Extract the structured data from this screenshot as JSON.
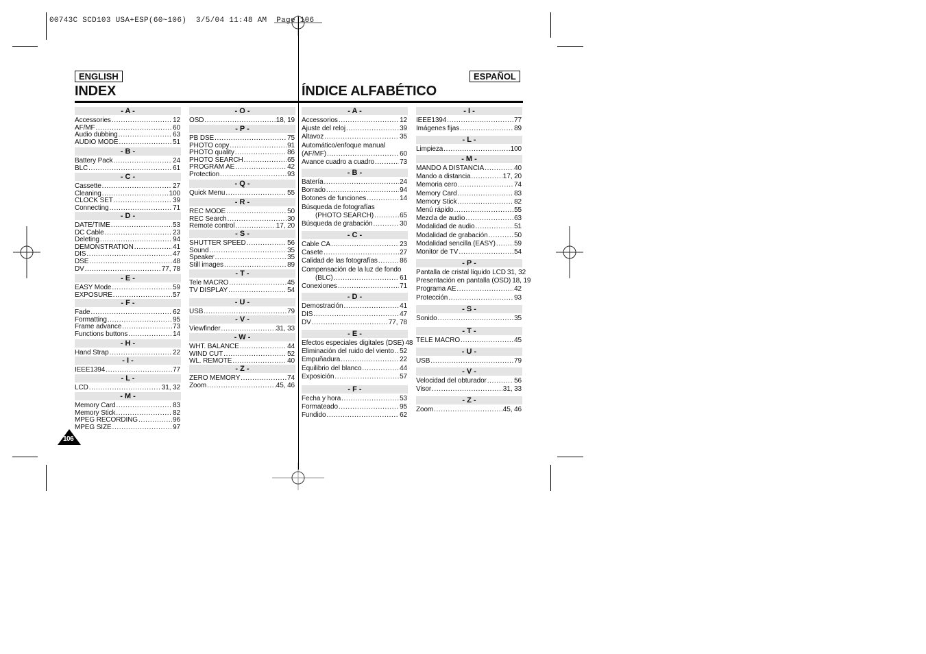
{
  "slug": "00743C SCD103 USA+ESP(60~106)  3/5/04 11:48 AM  Page 106",
  "page_number": "106",
  "english": {
    "lang_tag": "ENGLISH",
    "title": "INDEX",
    "columns": [
      [
        {
          "letter": "- A -",
          "entries": [
            {
              "label": "Accessories",
              "page": "12"
            },
            {
              "label": "AF/MF",
              "page": "60"
            },
            {
              "label": "Audio dubbing",
              "page": "63"
            },
            {
              "label": "AUDIO MODE",
              "page": "51"
            }
          ]
        },
        {
          "letter": "- B -",
          "entries": [
            {
              "label": "Battery Pack",
              "page": "24"
            },
            {
              "label": "BLC",
              "page": "61"
            }
          ]
        },
        {
          "letter": "- C -",
          "entries": [
            {
              "label": "Cassette",
              "page": "27"
            },
            {
              "label": "Cleaning",
              "page": "100"
            },
            {
              "label": "CLOCK SET",
              "page": "39"
            },
            {
              "label": "Connecting",
              "page": "71"
            }
          ]
        },
        {
          "letter": "- D -",
          "entries": [
            {
              "label": "DATE/TIME",
              "page": "53"
            },
            {
              "label": "DC Cable",
              "page": "23"
            },
            {
              "label": "Deleting",
              "page": "94"
            },
            {
              "label": "DEMONSTRATION",
              "page": "41"
            },
            {
              "label": "DIS",
              "page": "47"
            },
            {
              "label": "DSE",
              "page": "48"
            },
            {
              "label": "DV",
              "page": "77, 78"
            }
          ]
        },
        {
          "letter": "- E -",
          "entries": [
            {
              "label": "EASY Mode",
              "page": "59"
            },
            {
              "label": "EXPOSURE",
              "page": "57"
            }
          ]
        },
        {
          "letter": "- F -",
          "entries": [
            {
              "label": "Fade",
              "page": "62"
            },
            {
              "label": "Formatting",
              "page": "95"
            },
            {
              "label": "Frame advance",
              "page": "73"
            },
            {
              "label": "Functions buttons",
              "page": "14"
            }
          ]
        },
        {
          "letter": "- H -",
          "entries": [
            {
              "label": "Hand Strap",
              "page": "22"
            }
          ]
        },
        {
          "letter": "- I -",
          "entries": [
            {
              "label": "IEEE1394",
              "page": "77"
            }
          ]
        },
        {
          "letter": "- L -",
          "entries": [
            {
              "label": "LCD",
              "page": "31, 32"
            }
          ]
        },
        {
          "letter": "- M -",
          "entries": [
            {
              "label": "Memory Card",
              "page": "83"
            },
            {
              "label": "Memory Stick",
              "page": "82"
            },
            {
              "label": "MPEG RECORDING",
              "page": "96"
            },
            {
              "label": "MPEG SIZE",
              "page": "97"
            }
          ]
        }
      ],
      [
        {
          "letter": "- O -",
          "entries": [
            {
              "label": "OSD",
              "page": "18, 19"
            }
          ]
        },
        {
          "letter": "- P -",
          "entries": [
            {
              "label": "PB DSE",
              "page": "75"
            },
            {
              "label": "PHOTO copy",
              "page": "91"
            },
            {
              "label": "PHOTO quality",
              "page": "86"
            },
            {
              "label": "PHOTO SEARCH",
              "page": "65"
            },
            {
              "label": "PROGRAM AE",
              "page": "42"
            },
            {
              "label": "Protection",
              "page": "93"
            }
          ]
        },
        {
          "letter": "- Q -",
          "entries": [
            {
              "label": "Quick Menu",
              "page": "55"
            }
          ]
        },
        {
          "letter": "- R -",
          "entries": [
            {
              "label": "REC MODE",
              "page": "50"
            },
            {
              "label": "REC Search",
              "page": "30"
            },
            {
              "label": "Remote control",
              "page": "17, 20"
            }
          ]
        },
        {
          "letter": "- S -",
          "entries": [
            {
              "label": "SHUTTER SPEED",
              "page": "56"
            },
            {
              "label": "Sound",
              "page": "35"
            },
            {
              "label": "Speaker",
              "page": "35"
            },
            {
              "label": "Still images",
              "page": "89"
            }
          ]
        },
        {
          "letter": "- T -",
          "entries": [
            {
              "label": "Tele MACRO",
              "page": "45"
            },
            {
              "label": "TV DISPLAY",
              "page": "54"
            }
          ]
        },
        {
          "letter": "- U -",
          "entries": [
            {
              "label": "USB",
              "page": "79"
            }
          ]
        },
        {
          "letter": "- V -",
          "entries": [
            {
              "label": "Viewfinder",
              "page": "31, 33"
            }
          ]
        },
        {
          "letter": "- W -",
          "entries": [
            {
              "label": "WHT. BALANCE",
              "page": "44"
            },
            {
              "label": "WIND CUT",
              "page": "52"
            },
            {
              "label": "WL. REMOTE",
              "page": "40"
            }
          ]
        },
        {
          "letter": "- Z -",
          "entries": [
            {
              "label": "ZERO MEMORY",
              "page": "74"
            },
            {
              "label": "Zoom",
              "page": "45, 46"
            }
          ]
        }
      ]
    ]
  },
  "spanish": {
    "lang_tag": "ESPAÑOL",
    "title": "ÍNDICE ALFABÉTICO",
    "columns": [
      [
        {
          "letter": "- A -",
          "entries": [
            {
              "label": "Accessorios",
              "page": "12"
            },
            {
              "label": "Ajuste del reloj",
              "page": "39"
            },
            {
              "label": "Altavoz",
              "page": "35"
            },
            {
              "label": "Automático/enfoque manual",
              "label2": "(AF/MF)",
              "page": "60"
            },
            {
              "label": "Avance cuadro a cuadro",
              "page": "73"
            }
          ]
        },
        {
          "letter": "- B -",
          "entries": [
            {
              "label": "Batería",
              "page": "24"
            },
            {
              "label": "Borrado",
              "page": "94"
            },
            {
              "label": "Botones de funciones",
              "page": "14"
            },
            {
              "label": "Búsqueda de fotografías",
              "label2": "(PHOTO SEARCH)",
              "indent": true,
              "page": "65"
            },
            {
              "label": "Búsqueda de grabación",
              "page": "30"
            }
          ]
        },
        {
          "letter": "- C -",
          "entries": [
            {
              "label": "Cable CA",
              "page": "23"
            },
            {
              "label": "Casete",
              "page": "27"
            },
            {
              "label": "Calidad de las fotografías",
              "page": "86"
            },
            {
              "label": "Compensación de la luz de fondo",
              "label2": "(BLC)",
              "indent": true,
              "page": "61"
            },
            {
              "label": "Conexiones",
              "page": "71"
            }
          ]
        },
        {
          "letter": "- D -",
          "entries": [
            {
              "label": "Demostración",
              "page": "41"
            },
            {
              "label": "DIS",
              "page": "47"
            },
            {
              "label": "DV",
              "page": "77, 78"
            }
          ]
        },
        {
          "letter": "- E -",
          "entries": [
            {
              "label": "Efectos especiales digitales (DSE)",
              "page": "48"
            },
            {
              "label": "Eliminación del ruido del viento",
              "page": "52"
            },
            {
              "label": "Empuñadura",
              "page": "22"
            },
            {
              "label": "Equilibrio del blanco",
              "page": "44"
            },
            {
              "label": "Exposición",
              "page": "57"
            }
          ]
        },
        {
          "letter": "- F -",
          "entries": [
            {
              "label": "Fecha y hora",
              "page": "53"
            },
            {
              "label": "Formateado",
              "page": "95"
            },
            {
              "label": "Fundido",
              "page": "62"
            }
          ]
        }
      ],
      [
        {
          "letter": "- I -",
          "entries": [
            {
              "label": "IEEE1394",
              "page": "77"
            },
            {
              "label": "Imágenes fijas",
              "page": "89"
            }
          ]
        },
        {
          "letter": "- L -",
          "entries": [
            {
              "label": "Limpieza",
              "page": "100"
            }
          ]
        },
        {
          "letter": "- M -",
          "entries": [
            {
              "label": "MANDO A DISTANCIA",
              "page": "40"
            },
            {
              "label": "Mando a distancia",
              "page": "17, 20"
            },
            {
              "label": "Memoria cero",
              "page": "74"
            },
            {
              "label": "Memory Card",
              "page": "83"
            },
            {
              "label": "Memory Stick",
              "page": "82"
            },
            {
              "label": "Menú rápido",
              "page": "55"
            },
            {
              "label": "Mezcla de audio",
              "page": "63"
            },
            {
              "label": "Modalidad de audio",
              "page": "51"
            },
            {
              "label": "Modalidad de grabación",
              "page": "50"
            },
            {
              "label": "Modalidad sencilla (EASY)",
              "page": "59"
            },
            {
              "label": "Monitor de TV",
              "page": "54"
            }
          ]
        },
        {
          "letter": "- P -",
          "entries": [
            {
              "label": "Pantalla de cristal líquido LCD",
              "page": "31, 32"
            },
            {
              "label": "Presentación en pantalla (OSD)",
              "page": "18, 19"
            },
            {
              "label": "Programa AE",
              "page": "42"
            },
            {
              "label": "Protección",
              "page": "93"
            }
          ]
        },
        {
          "letter": "- S -",
          "entries": [
            {
              "label": "Sonido",
              "page": "35"
            }
          ]
        },
        {
          "letter": "- T -",
          "entries": [
            {
              "label": "TELE MACRO",
              "page": "45"
            }
          ]
        },
        {
          "letter": "- U -",
          "entries": [
            {
              "label": "USB",
              "page": "79"
            }
          ]
        },
        {
          "letter": "- V -",
          "entries": [
            {
              "label": "Velocidad del obturador",
              "page": "56"
            },
            {
              "label": "Visor",
              "page": "31, 33"
            }
          ]
        },
        {
          "letter": "- Z -",
          "entries": [
            {
              "label": "Zoom",
              "page": "45, 46"
            }
          ]
        }
      ]
    ]
  }
}
